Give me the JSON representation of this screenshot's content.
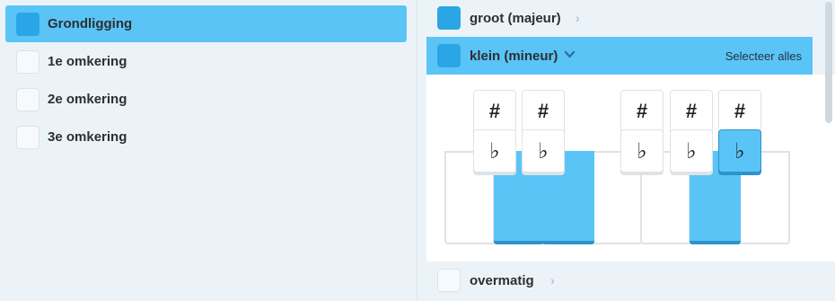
{
  "inversions": [
    {
      "label": "Grondligging",
      "checked": true,
      "selected": true
    },
    {
      "label": "1e omkering",
      "checked": false,
      "selected": false
    },
    {
      "label": "2e omkering",
      "checked": false,
      "selected": false
    },
    {
      "label": "3e omkering",
      "checked": false,
      "selected": false
    }
  ],
  "chords": {
    "major": {
      "label": "groot (majeur)",
      "checked": true,
      "expanded": false
    },
    "minor": {
      "label": "klein (mineur)",
      "checked": true,
      "expanded": true,
      "select_all": "Selecteer alles"
    },
    "augmented": {
      "label": "overmatig",
      "checked": false,
      "expanded": false
    }
  },
  "piano": {
    "sharp_symbol": "#",
    "flat_symbol": "♭",
    "active_flat_index": 4
  },
  "colors": {
    "accent": "#5bc4f6",
    "checkbox_on": "#2aa6e6",
    "key_border": "#2d93c9"
  },
  "icons": {
    "collapsed": "chevron-right-icon",
    "expanded": "chevron-down-icon"
  }
}
